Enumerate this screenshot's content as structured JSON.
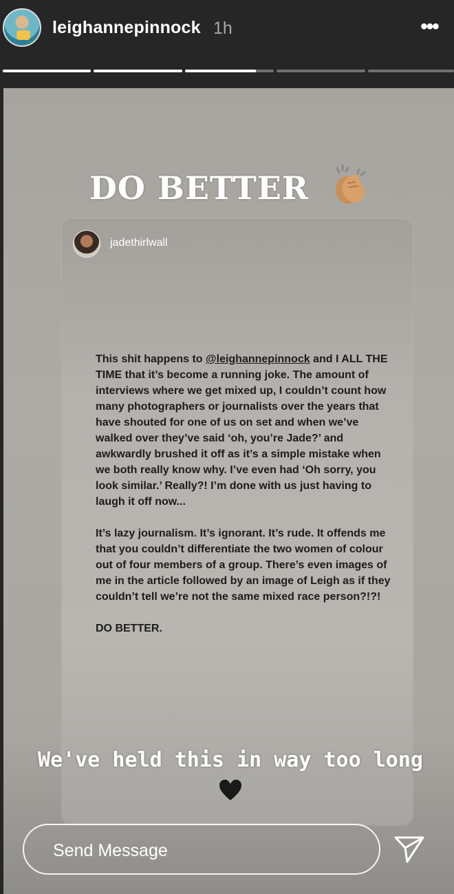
{
  "header": {
    "username": "leighannepinnock",
    "time": "1h",
    "more_icon": "more-horizontal-icon",
    "progress_segments": [
      1,
      1,
      0.8,
      0,
      0
    ]
  },
  "story": {
    "headline": "DO BETTER",
    "headline_emoji": "clapping-hands-icon",
    "post": {
      "username": "jadethirlwall",
      "paragraph1_mention": "@leighannepinnock",
      "paragraph1_before": "This shit happens to ",
      "paragraph1_after": " and I ALL THE TIME that it’s become a running joke. The amount of interviews where we get mixed up, I couldn’t count how many photographers or journalists over the years that have shouted for one of us on set and when we’ve walked over they’ve said ‘oh, you’re Jade?’ and awkwardly brushed it off as it’s a simple mistake when we both really know why. I’ve even had ‘Oh sorry, you look similar.’ Really?! I’m done with us just having to laugh it off now...",
      "paragraph2": "It’s lazy journalism. It’s ignorant. It’s rude. It offends me that you couldn’t differentiate the two women of colour out of four members of a group. There’s even images of me in the article followed by an image of Leigh as if they couldn’t tell we’re not the same mixed race person?!?!",
      "paragraph3": "DO BETTER."
    },
    "caption": "We've held this in way too long",
    "caption_emoji": "black-heart-icon"
  },
  "footer": {
    "message_placeholder": "Send Message",
    "send_icon": "paper-plane-icon"
  },
  "colors": {
    "header_bg": "#262626",
    "story_bg": "#aaa7a2",
    "text_dark": "#1c1c1c",
    "white": "#ffffff"
  }
}
